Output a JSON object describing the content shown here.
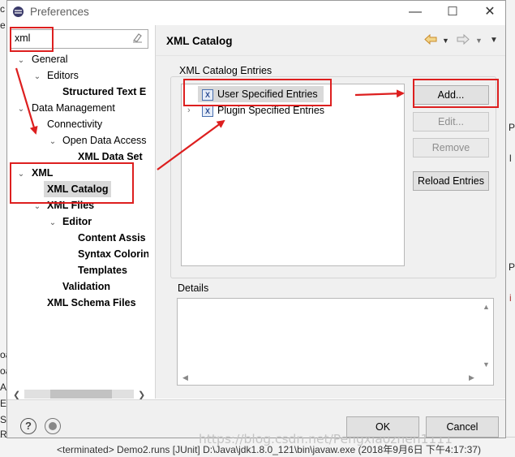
{
  "background": {
    "left_letters": [
      "c",
      "e",
      "",
      "",
      "",
      "",
      "",
      "",
      "",
      "",
      "",
      "",
      "",
      "",
      "",
      "",
      "",
      "",
      "",
      "",
      "",
      "oa",
      "oa",
      "A",
      "E",
      "SE",
      "R"
    ],
    "right_letters": [
      "P",
      "l",
      "P",
      "i"
    ],
    "status_line": "<terminated> Demo2.runs [JUnit] D:\\Java\\jdk1.8.0_121\\bin\\javaw.exe (2018年9月6日 下午4:17:37)"
  },
  "window": {
    "title": "Preferences",
    "minimize": "—",
    "maximize": "☐",
    "close": "✕"
  },
  "filter": {
    "value": "xml",
    "clear_icon": "eraser-icon"
  },
  "tree": [
    {
      "label": "General",
      "expanded": true,
      "bold": false
    },
    {
      "label": "Editors",
      "expanded": true,
      "bold": false
    },
    {
      "label": "Structured Text E",
      "bold": true
    },
    {
      "label": "Data Management",
      "expanded": true,
      "bold": false
    },
    {
      "label": "Connectivity",
      "bold": false
    },
    {
      "label": "Open Data Access",
      "expanded": true,
      "bold": false
    },
    {
      "label": "XML Data Set",
      "bold": true
    },
    {
      "label": "XML",
      "expanded": true,
      "bold": true
    },
    {
      "label": "XML Catalog",
      "bold": true,
      "selected": true
    },
    {
      "label": "XML Files",
      "expanded": true,
      "bold": true
    },
    {
      "label": "Editor",
      "expanded": true,
      "bold": true
    },
    {
      "label": "Content Assis",
      "bold": true
    },
    {
      "label": "Syntax Colorin",
      "bold": true
    },
    {
      "label": "Templates",
      "bold": true
    },
    {
      "label": "Validation",
      "bold": true
    },
    {
      "label": "XML Schema Files",
      "bold": true
    }
  ],
  "page": {
    "title": "XML Catalog",
    "back_icon": "back-arrow-icon",
    "forward_icon": "forward-arrow-icon",
    "menu_icon": "view-menu-icon",
    "entries_label": "XML Catalog Entries",
    "entries": [
      {
        "label": "User Specified Entries",
        "selected": true
      },
      {
        "label": "Plugin Specified Entries",
        "selected": false
      }
    ],
    "buttons": {
      "add": "Add...",
      "edit": "Edit...",
      "remove": "Remove",
      "reload": "Reload Entries"
    },
    "details_label": "Details"
  },
  "footer": {
    "help_icon": "help-icon",
    "import_icon": "import-export-icon",
    "ok": "OK",
    "cancel": "Cancel"
  },
  "watermark": "https://blog.csdn.net/Pengxiaozhen1111",
  "colors": {
    "annotation_red": "#dd1f1f",
    "accent_orange": "#d08a3a"
  }
}
